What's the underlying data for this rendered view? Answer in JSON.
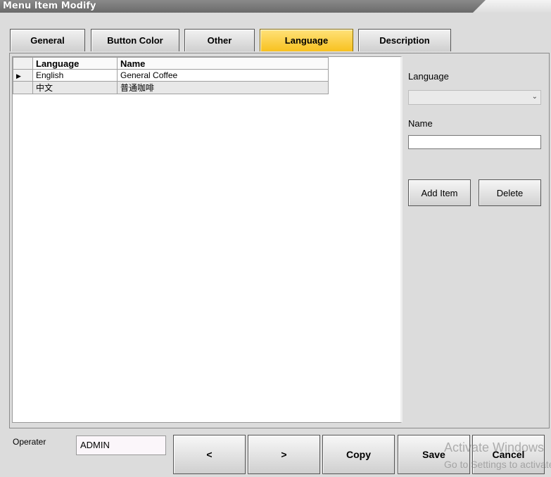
{
  "window": {
    "title": "Menu Item Modify"
  },
  "tabs": [
    {
      "label": "General"
    },
    {
      "label": "Button Color"
    },
    {
      "label": "Other"
    },
    {
      "label": "Language"
    },
    {
      "label": "Description"
    }
  ],
  "grid": {
    "columns": [
      "Language",
      "Name"
    ],
    "rows": [
      {
        "language": "English",
        "name": "General Coffee"
      },
      {
        "language": "中文",
        "name": "普通咖啡"
      }
    ]
  },
  "editor": {
    "language_label": "Language",
    "language_value": "",
    "name_label": "Name",
    "name_value": "",
    "add_label": "Add Item",
    "delete_label": "Delete"
  },
  "bottom": {
    "operator_label": "Operater",
    "operator_value": "ADMIN",
    "prev_label": "<",
    "next_label": ">",
    "copy_label": "Copy",
    "save_label": "Save",
    "cancel_label": "Cancel"
  },
  "watermark": {
    "line1": "Activate Windows",
    "line2": "Go to Settings to activate Windows."
  },
  "colors": {
    "active_tab": "#f8c11f",
    "background": "#dcdcdc"
  }
}
